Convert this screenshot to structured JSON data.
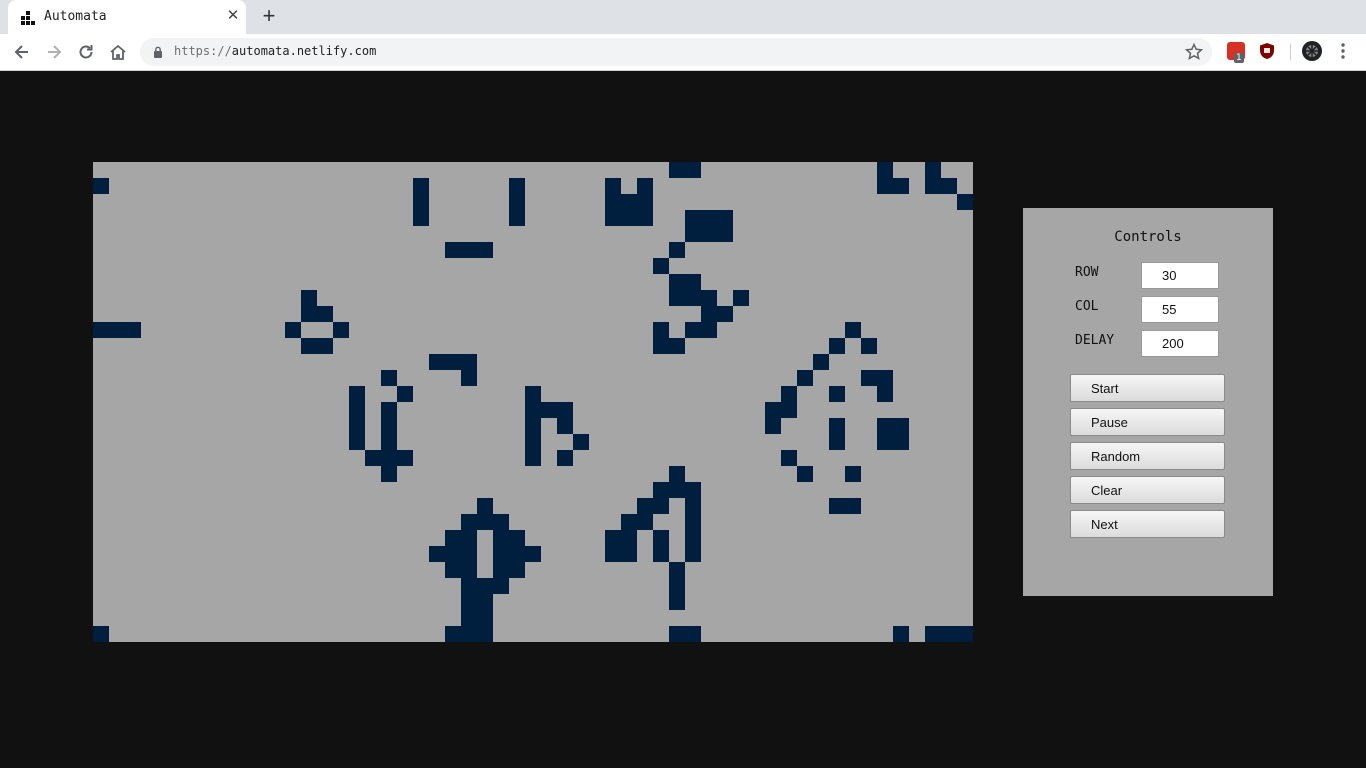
{
  "browser": {
    "tab_title": "Automata",
    "tab_close": "✕",
    "new_tab": "+",
    "url_scheme": "https://",
    "url_host": "automata.netlify.com",
    "badge_count": "1"
  },
  "grid": {
    "rows": 30,
    "cols": 55,
    "live_color": "#001f3f",
    "dead_color": "#a6a6a6",
    "live_cells": [
      [
        0,
        36
      ],
      [
        0,
        37
      ],
      [
        0,
        49
      ],
      [
        0,
        52
      ],
      [
        1,
        0
      ],
      [
        1,
        20
      ],
      [
        1,
        26
      ],
      [
        1,
        32
      ],
      [
        1,
        34
      ],
      [
        1,
        49
      ],
      [
        1,
        50
      ],
      [
        1,
        52
      ],
      [
        1,
        53
      ],
      [
        2,
        20
      ],
      [
        2,
        26
      ],
      [
        2,
        32
      ],
      [
        2,
        33
      ],
      [
        2,
        34
      ],
      [
        2,
        54
      ],
      [
        3,
        20
      ],
      [
        3,
        26
      ],
      [
        3,
        32
      ],
      [
        3,
        33
      ],
      [
        3,
        34
      ],
      [
        3,
        37
      ],
      [
        3,
        38
      ],
      [
        3,
        39
      ],
      [
        4,
        37
      ],
      [
        4,
        38
      ],
      [
        4,
        39
      ],
      [
        5,
        22
      ],
      [
        5,
        23
      ],
      [
        5,
        24
      ],
      [
        5,
        36
      ],
      [
        6,
        35
      ],
      [
        7,
        36
      ],
      [
        7,
        37
      ],
      [
        8,
        13
      ],
      [
        8,
        36
      ],
      [
        8,
        37
      ],
      [
        8,
        38
      ],
      [
        8,
        40
      ],
      [
        9,
        13
      ],
      [
        9,
        14
      ],
      [
        9,
        38
      ],
      [
        9,
        39
      ],
      [
        10,
        0
      ],
      [
        10,
        1
      ],
      [
        10,
        2
      ],
      [
        10,
        12
      ],
      [
        10,
        15
      ],
      [
        10,
        35
      ],
      [
        10,
        37
      ],
      [
        10,
        38
      ],
      [
        10,
        47
      ],
      [
        11,
        13
      ],
      [
        11,
        14
      ],
      [
        11,
        35
      ],
      [
        11,
        36
      ],
      [
        11,
        46
      ],
      [
        11,
        48
      ],
      [
        12,
        21
      ],
      [
        12,
        22
      ],
      [
        12,
        23
      ],
      [
        12,
        45
      ],
      [
        13,
        18
      ],
      [
        13,
        23
      ],
      [
        13,
        44
      ],
      [
        13,
        48
      ],
      [
        13,
        49
      ],
      [
        14,
        16
      ],
      [
        14,
        19
      ],
      [
        14,
        27
      ],
      [
        14,
        43
      ],
      [
        14,
        46
      ],
      [
        14,
        49
      ],
      [
        15,
        16
      ],
      [
        15,
        18
      ],
      [
        15,
        27
      ],
      [
        15,
        28
      ],
      [
        15,
        29
      ],
      [
        15,
        42
      ],
      [
        15,
        43
      ],
      [
        16,
        16
      ],
      [
        16,
        18
      ],
      [
        16,
        27
      ],
      [
        16,
        29
      ],
      [
        16,
        42
      ],
      [
        16,
        46
      ],
      [
        16,
        49
      ],
      [
        16,
        50
      ],
      [
        17,
        16
      ],
      [
        17,
        18
      ],
      [
        17,
        27
      ],
      [
        17,
        30
      ],
      [
        17,
        46
      ],
      [
        17,
        49
      ],
      [
        17,
        50
      ],
      [
        18,
        17
      ],
      [
        18,
        18
      ],
      [
        18,
        19
      ],
      [
        18,
        27
      ],
      [
        18,
        29
      ],
      [
        18,
        43
      ],
      [
        19,
        18
      ],
      [
        19,
        36
      ],
      [
        19,
        44
      ],
      [
        19,
        47
      ],
      [
        20,
        35
      ],
      [
        20,
        36
      ],
      [
        20,
        37
      ],
      [
        21,
        24
      ],
      [
        21,
        34
      ],
      [
        21,
        35
      ],
      [
        21,
        37
      ],
      [
        21,
        46
      ],
      [
        21,
        47
      ],
      [
        22,
        23
      ],
      [
        22,
        24
      ],
      [
        22,
        25
      ],
      [
        22,
        33
      ],
      [
        22,
        34
      ],
      [
        22,
        37
      ],
      [
        23,
        22
      ],
      [
        23,
        23
      ],
      [
        23,
        25
      ],
      [
        23,
        26
      ],
      [
        23,
        32
      ],
      [
        23,
        33
      ],
      [
        23,
        35
      ],
      [
        23,
        37
      ],
      [
        24,
        21
      ],
      [
        24,
        22
      ],
      [
        24,
        23
      ],
      [
        24,
        25
      ],
      [
        24,
        26
      ],
      [
        24,
        27
      ],
      [
        24,
        32
      ],
      [
        24,
        33
      ],
      [
        24,
        35
      ],
      [
        24,
        37
      ],
      [
        25,
        22
      ],
      [
        25,
        23
      ],
      [
        25,
        25
      ],
      [
        25,
        26
      ],
      [
        25,
        36
      ],
      [
        26,
        23
      ],
      [
        26,
        24
      ],
      [
        26,
        25
      ],
      [
        26,
        36
      ],
      [
        27,
        23
      ],
      [
        27,
        24
      ],
      [
        27,
        36
      ],
      [
        28,
        23
      ],
      [
        28,
        24
      ],
      [
        29,
        0
      ],
      [
        29,
        22
      ],
      [
        29,
        23
      ],
      [
        29,
        24
      ],
      [
        29,
        36
      ],
      [
        29,
        37
      ],
      [
        29,
        50
      ],
      [
        29,
        52
      ],
      [
        29,
        53
      ],
      [
        29,
        54
      ]
    ]
  },
  "controls": {
    "title": "Controls",
    "row_label": "ROW",
    "row_value": "30",
    "col_label": "COL",
    "col_value": "55",
    "delay_label": "DELAY",
    "delay_value": "200",
    "start_label": "Start",
    "pause_label": "Pause",
    "random_label": "Random",
    "clear_label": "Clear",
    "next_label": "Next"
  }
}
